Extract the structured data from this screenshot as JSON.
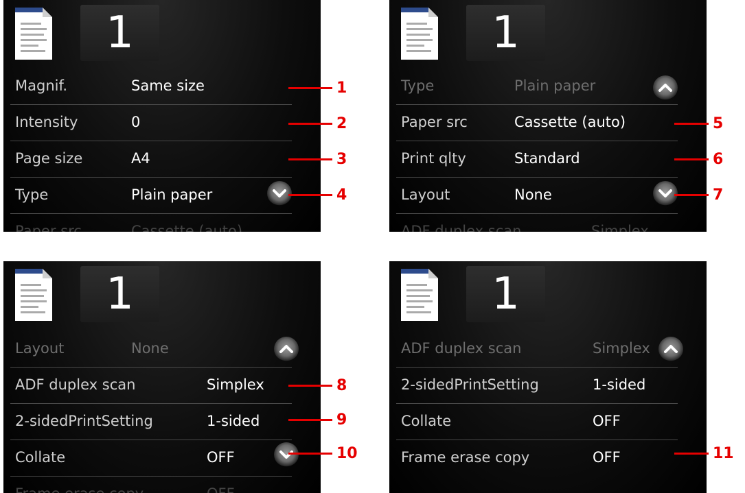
{
  "panels": [
    {
      "count": "1",
      "rows": [
        {
          "label": "Magnif.",
          "value": "Same size"
        },
        {
          "label": "Intensity",
          "value": "0"
        },
        {
          "label": "Page size",
          "value": "A4"
        },
        {
          "label": "Type",
          "value": "Plain paper"
        },
        {
          "label": "Paper src",
          "value": "Cassette (auto)"
        }
      ]
    },
    {
      "count": "1",
      "rows": [
        {
          "label": "Type",
          "value": "Plain paper"
        },
        {
          "label": "Paper src",
          "value": "Cassette (auto)"
        },
        {
          "label": "Print qlty",
          "value": "Standard"
        },
        {
          "label": "Layout",
          "value": "None"
        },
        {
          "label": "ADF duplex scan",
          "value": "Simplex"
        }
      ]
    },
    {
      "count": "1",
      "rows": [
        {
          "label": "Layout",
          "value": "None"
        },
        {
          "label": "ADF duplex scan",
          "value": "Simplex"
        },
        {
          "label": "2-sidedPrintSetting",
          "value": "1-sided"
        },
        {
          "label": "Collate",
          "value": "OFF"
        },
        {
          "label": "Frame erase copy",
          "value": "OFF"
        }
      ]
    },
    {
      "count": "1",
      "rows": [
        {
          "label": "ADF duplex scan",
          "value": "Simplex"
        },
        {
          "label": "2-sidedPrintSetting",
          "value": "1-sided"
        },
        {
          "label": "Collate",
          "value": "OFF"
        },
        {
          "label": "Frame erase copy",
          "value": "OFF"
        }
      ]
    }
  ],
  "callouts": [
    "1",
    "2",
    "3",
    "4",
    "5",
    "6",
    "7",
    "8",
    "9",
    "10",
    "11"
  ],
  "colors": {
    "callout": "#e60000",
    "panel_bg": "#000000",
    "text": "#ffffff"
  },
  "icons": [
    "document-icon",
    "scroll-up-icon",
    "scroll-down-icon"
  ]
}
